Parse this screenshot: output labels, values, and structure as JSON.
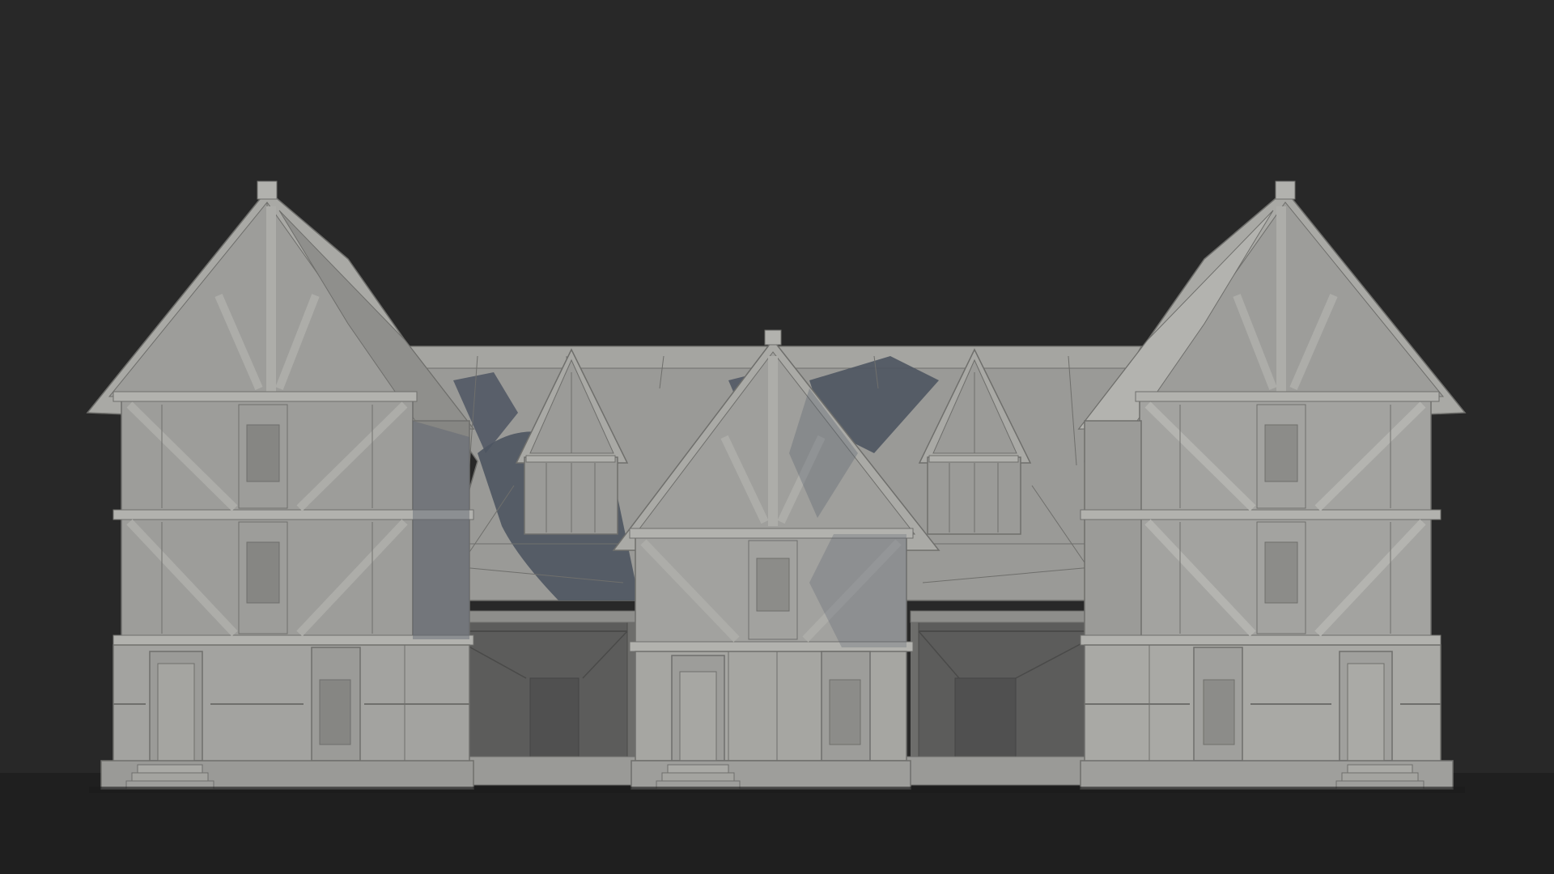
{
  "scene": {
    "subject": "tudor-building-grey-model",
    "colors": {
      "background": "#282828",
      "floor": "#1f1f1f",
      "wall": "#9c9c98",
      "wall_light": "#b4b4b0",
      "wall_dark": "#858582",
      "roof": "#8f8f8c",
      "roof_light": "#a6a6a2",
      "shadow": "#4e5561",
      "timber": "#a9a9a5",
      "line": "#6f6f6c"
    }
  }
}
